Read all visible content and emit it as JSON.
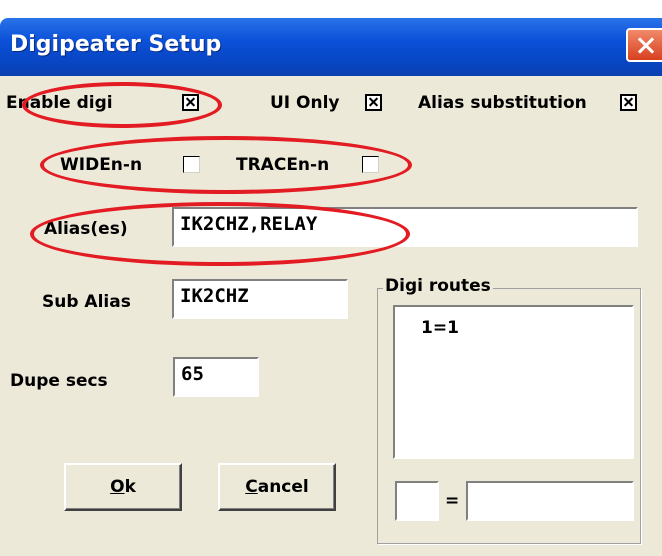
{
  "window": {
    "title": "Digipeater Setup"
  },
  "options": {
    "enable_digi": {
      "label": "Enable digi",
      "checked": true
    },
    "ui_only": {
      "label": "UI Only",
      "checked": true
    },
    "alias_substitution": {
      "label": "Alias substitution",
      "checked": true
    },
    "widen": {
      "label": "WIDEn-n",
      "checked": false
    },
    "tracen": {
      "label": "TRACEn-n",
      "checked": false
    }
  },
  "fields": {
    "aliases": {
      "label": "Alias(es)",
      "value": "IK2CHZ,RELAY"
    },
    "sub_alias": {
      "label": "Sub Alias",
      "value": "IK2CHZ"
    },
    "dupe_secs": {
      "label": "Dupe secs",
      "value": "65"
    }
  },
  "digi_routes": {
    "title": "Digi routes",
    "items": [
      "1=1"
    ],
    "from_value": "",
    "equals_sign": "=",
    "to_value": ""
  },
  "buttons": {
    "ok": {
      "accel": "O",
      "rest": "k"
    },
    "cancel": {
      "accel": "C",
      "rest": "ancel"
    }
  },
  "annotation_color": "#e31b23"
}
